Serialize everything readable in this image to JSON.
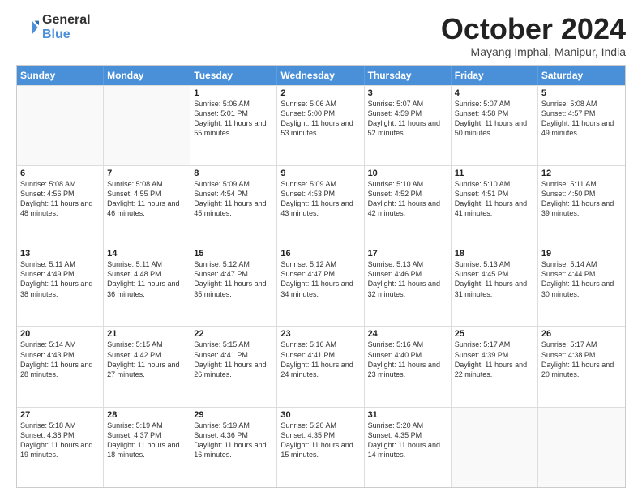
{
  "logo": {
    "general": "General",
    "blue": "Blue"
  },
  "header": {
    "month": "October 2024",
    "location": "Mayang Imphal, Manipur, India"
  },
  "weekdays": [
    "Sunday",
    "Monday",
    "Tuesday",
    "Wednesday",
    "Thursday",
    "Friday",
    "Saturday"
  ],
  "weeks": [
    [
      {
        "day": "",
        "sunrise": "",
        "sunset": "",
        "daylight": ""
      },
      {
        "day": "",
        "sunrise": "",
        "sunset": "",
        "daylight": ""
      },
      {
        "day": "1",
        "sunrise": "Sunrise: 5:06 AM",
        "sunset": "Sunset: 5:01 PM",
        "daylight": "Daylight: 11 hours and 55 minutes."
      },
      {
        "day": "2",
        "sunrise": "Sunrise: 5:06 AM",
        "sunset": "Sunset: 5:00 PM",
        "daylight": "Daylight: 11 hours and 53 minutes."
      },
      {
        "day": "3",
        "sunrise": "Sunrise: 5:07 AM",
        "sunset": "Sunset: 4:59 PM",
        "daylight": "Daylight: 11 hours and 52 minutes."
      },
      {
        "day": "4",
        "sunrise": "Sunrise: 5:07 AM",
        "sunset": "Sunset: 4:58 PM",
        "daylight": "Daylight: 11 hours and 50 minutes."
      },
      {
        "day": "5",
        "sunrise": "Sunrise: 5:08 AM",
        "sunset": "Sunset: 4:57 PM",
        "daylight": "Daylight: 11 hours and 49 minutes."
      }
    ],
    [
      {
        "day": "6",
        "sunrise": "Sunrise: 5:08 AM",
        "sunset": "Sunset: 4:56 PM",
        "daylight": "Daylight: 11 hours and 48 minutes."
      },
      {
        "day": "7",
        "sunrise": "Sunrise: 5:08 AM",
        "sunset": "Sunset: 4:55 PM",
        "daylight": "Daylight: 11 hours and 46 minutes."
      },
      {
        "day": "8",
        "sunrise": "Sunrise: 5:09 AM",
        "sunset": "Sunset: 4:54 PM",
        "daylight": "Daylight: 11 hours and 45 minutes."
      },
      {
        "day": "9",
        "sunrise": "Sunrise: 5:09 AM",
        "sunset": "Sunset: 4:53 PM",
        "daylight": "Daylight: 11 hours and 43 minutes."
      },
      {
        "day": "10",
        "sunrise": "Sunrise: 5:10 AM",
        "sunset": "Sunset: 4:52 PM",
        "daylight": "Daylight: 11 hours and 42 minutes."
      },
      {
        "day": "11",
        "sunrise": "Sunrise: 5:10 AM",
        "sunset": "Sunset: 4:51 PM",
        "daylight": "Daylight: 11 hours and 41 minutes."
      },
      {
        "day": "12",
        "sunrise": "Sunrise: 5:11 AM",
        "sunset": "Sunset: 4:50 PM",
        "daylight": "Daylight: 11 hours and 39 minutes."
      }
    ],
    [
      {
        "day": "13",
        "sunrise": "Sunrise: 5:11 AM",
        "sunset": "Sunset: 4:49 PM",
        "daylight": "Daylight: 11 hours and 38 minutes."
      },
      {
        "day": "14",
        "sunrise": "Sunrise: 5:11 AM",
        "sunset": "Sunset: 4:48 PM",
        "daylight": "Daylight: 11 hours and 36 minutes."
      },
      {
        "day": "15",
        "sunrise": "Sunrise: 5:12 AM",
        "sunset": "Sunset: 4:47 PM",
        "daylight": "Daylight: 11 hours and 35 minutes."
      },
      {
        "day": "16",
        "sunrise": "Sunrise: 5:12 AM",
        "sunset": "Sunset: 4:47 PM",
        "daylight": "Daylight: 11 hours and 34 minutes."
      },
      {
        "day": "17",
        "sunrise": "Sunrise: 5:13 AM",
        "sunset": "Sunset: 4:46 PM",
        "daylight": "Daylight: 11 hours and 32 minutes."
      },
      {
        "day": "18",
        "sunrise": "Sunrise: 5:13 AM",
        "sunset": "Sunset: 4:45 PM",
        "daylight": "Daylight: 11 hours and 31 minutes."
      },
      {
        "day": "19",
        "sunrise": "Sunrise: 5:14 AM",
        "sunset": "Sunset: 4:44 PM",
        "daylight": "Daylight: 11 hours and 30 minutes."
      }
    ],
    [
      {
        "day": "20",
        "sunrise": "Sunrise: 5:14 AM",
        "sunset": "Sunset: 4:43 PM",
        "daylight": "Daylight: 11 hours and 28 minutes."
      },
      {
        "day": "21",
        "sunrise": "Sunrise: 5:15 AM",
        "sunset": "Sunset: 4:42 PM",
        "daylight": "Daylight: 11 hours and 27 minutes."
      },
      {
        "day": "22",
        "sunrise": "Sunrise: 5:15 AM",
        "sunset": "Sunset: 4:41 PM",
        "daylight": "Daylight: 11 hours and 26 minutes."
      },
      {
        "day": "23",
        "sunrise": "Sunrise: 5:16 AM",
        "sunset": "Sunset: 4:41 PM",
        "daylight": "Daylight: 11 hours and 24 minutes."
      },
      {
        "day": "24",
        "sunrise": "Sunrise: 5:16 AM",
        "sunset": "Sunset: 4:40 PM",
        "daylight": "Daylight: 11 hours and 23 minutes."
      },
      {
        "day": "25",
        "sunrise": "Sunrise: 5:17 AM",
        "sunset": "Sunset: 4:39 PM",
        "daylight": "Daylight: 11 hours and 22 minutes."
      },
      {
        "day": "26",
        "sunrise": "Sunrise: 5:17 AM",
        "sunset": "Sunset: 4:38 PM",
        "daylight": "Daylight: 11 hours and 20 minutes."
      }
    ],
    [
      {
        "day": "27",
        "sunrise": "Sunrise: 5:18 AM",
        "sunset": "Sunset: 4:38 PM",
        "daylight": "Daylight: 11 hours and 19 minutes."
      },
      {
        "day": "28",
        "sunrise": "Sunrise: 5:19 AM",
        "sunset": "Sunset: 4:37 PM",
        "daylight": "Daylight: 11 hours and 18 minutes."
      },
      {
        "day": "29",
        "sunrise": "Sunrise: 5:19 AM",
        "sunset": "Sunset: 4:36 PM",
        "daylight": "Daylight: 11 hours and 16 minutes."
      },
      {
        "day": "30",
        "sunrise": "Sunrise: 5:20 AM",
        "sunset": "Sunset: 4:35 PM",
        "daylight": "Daylight: 11 hours and 15 minutes."
      },
      {
        "day": "31",
        "sunrise": "Sunrise: 5:20 AM",
        "sunset": "Sunset: 4:35 PM",
        "daylight": "Daylight: 11 hours and 14 minutes."
      },
      {
        "day": "",
        "sunrise": "",
        "sunset": "",
        "daylight": ""
      },
      {
        "day": "",
        "sunrise": "",
        "sunset": "",
        "daylight": ""
      }
    ]
  ]
}
